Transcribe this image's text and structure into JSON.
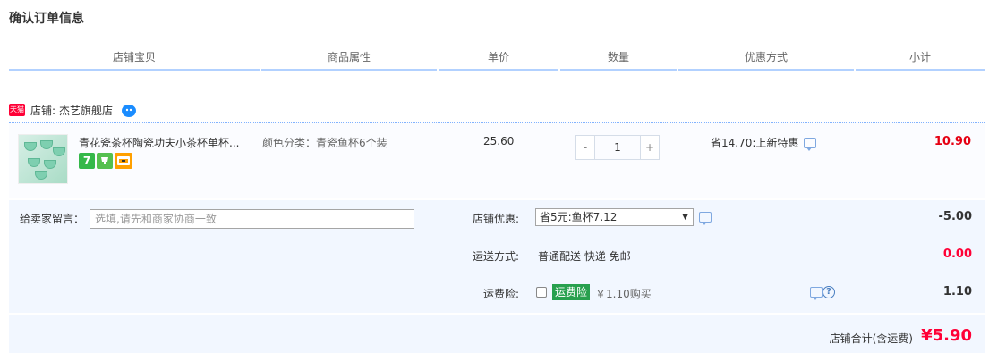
{
  "page_title": "确认订单信息",
  "columns": [
    "店铺宝贝",
    "商品属性",
    "单价",
    "数量",
    "优惠方式",
    "小计"
  ],
  "shop": {
    "badge": "天猫",
    "label": "店铺:",
    "name": "杰艺旗舰店"
  },
  "item": {
    "title": "青花瓷茶杯陶瓷功夫小茶杯单杯...",
    "tags": [
      "7",
      "杯",
      "卡"
    ],
    "attribute": "颜色分类：青瓷鱼杯6个装",
    "price": "25.60",
    "qty_minus": "-",
    "qty_value": "1",
    "qty_plus": "+",
    "promo": "省14.70:上新特惠",
    "subtotal": "10.90"
  },
  "remark": {
    "label": "给卖家留言：",
    "placeholder": "选填,请先和商家协商一致"
  },
  "shop_discount": {
    "label": "店铺优惠:",
    "selected": "省5元:鱼杯7.12",
    "amount": "-5.00"
  },
  "shipping": {
    "label": "运送方式:",
    "value": "普通配送 快递 免邮",
    "amount": "0.00"
  },
  "insurance": {
    "label": "运费险:",
    "badge": "运费险",
    "price_text": "￥1.10购买",
    "amount": "1.10"
  },
  "total": {
    "label": "店铺合计(含运费)",
    "amount": "¥5.90"
  },
  "colors": {
    "accent_red": "#ff0036",
    "subtotal_red": "#e60012",
    "header_line": "#b2d1ff",
    "panel_bg": "#f2f7ff",
    "insurance_green": "#28a04e"
  }
}
